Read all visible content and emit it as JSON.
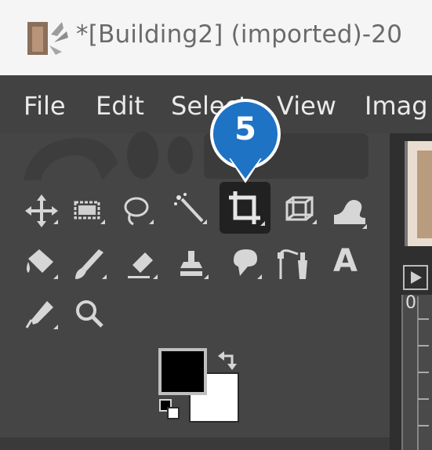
{
  "window": {
    "title": "*[Building2] (imported)-20"
  },
  "menu": {
    "items": [
      "File",
      "Edit",
      "Select",
      "View",
      "Imag"
    ]
  },
  "callout": {
    "number": "5",
    "color": "#1e73c5"
  },
  "toolbox": {
    "row1": [
      "move-tool-icon",
      "rect-select-tool-icon",
      "free-select-tool-icon",
      "fuzzy-select-tool-icon",
      "crop-tool-icon",
      "unified-transform-tool-icon",
      "warp-transform-tool-icon"
    ],
    "row2": [
      "bucket-fill-tool-icon",
      "paintbrush-tool-icon",
      "eraser-tool-icon",
      "clone-tool-icon",
      "smudge-tool-icon",
      "paths-tool-icon",
      "text-tool-icon"
    ],
    "row3": [
      "color-picker-tool-icon",
      "zoom-tool-icon"
    ],
    "active_tool": "crop-tool-icon",
    "text_tool_glyph": "A",
    "foreground_color": "#000000",
    "background_color": "#ffffff"
  },
  "canvas": {
    "ruler_start": "0"
  }
}
